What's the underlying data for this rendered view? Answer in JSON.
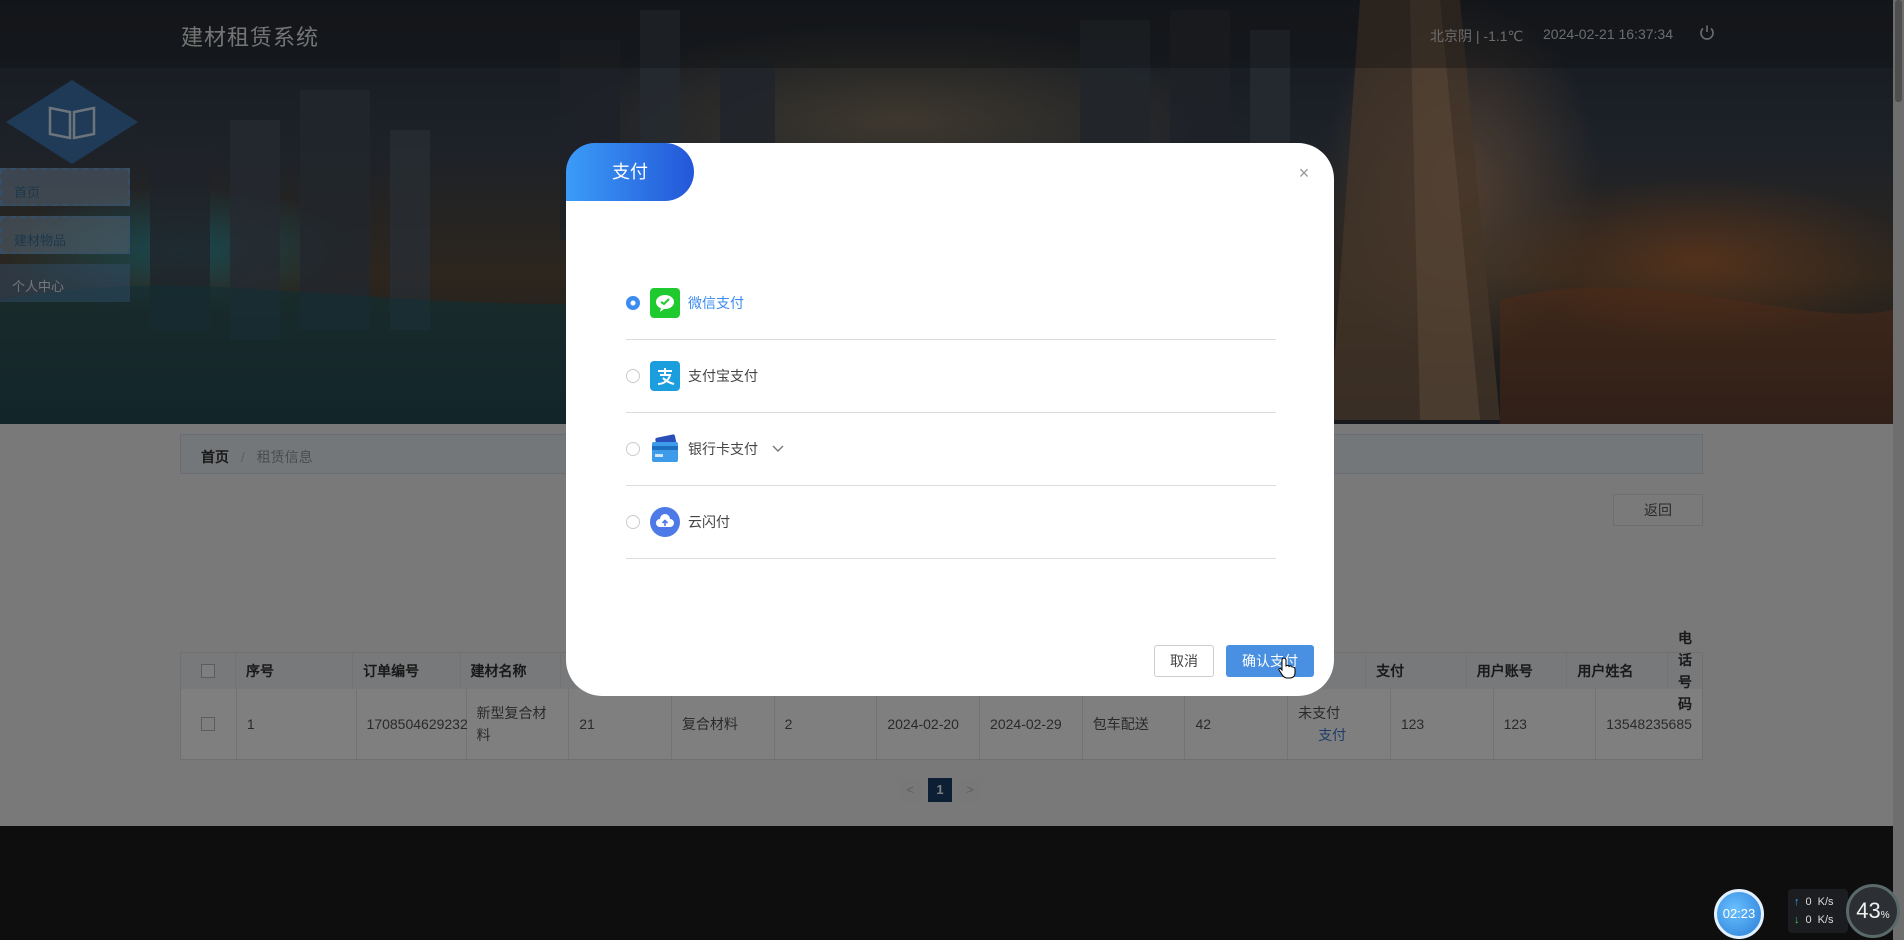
{
  "header": {
    "site_title": "建材租赁系统",
    "weather": "北京阴 | -1.1℃",
    "datetime": "2024-02-21   16:37:34"
  },
  "sidebar": {
    "items": [
      {
        "label": "首页"
      },
      {
        "label": "建材物品"
      },
      {
        "label": "个人中心"
      }
    ]
  },
  "breadcrumb": {
    "home": "首页",
    "separator": "/",
    "current": "租赁信息"
  },
  "back_button": "返回",
  "table": {
    "headers": [
      "序号",
      "订单编号",
      "建材名称",
      "",
      "",
      "",
      "",
      "",
      "",
      "",
      "",
      "支付",
      "用户账号",
      "用户姓名",
      "电话号码"
    ],
    "rows": [
      {
        "cells": [
          "1",
          "1708504629232",
          "新型复合材料",
          "21",
          "复合材料",
          "2",
          "2024-02-20",
          "2024-02-29",
          "包车配送",
          "42",
          "",
          "123",
          "123",
          "13548235685"
        ],
        "pay_status": "未支付",
        "pay_action": "支付"
      }
    ]
  },
  "pagination": {
    "prev": "<",
    "current": "1",
    "next": ">"
  },
  "modal": {
    "title": "支付",
    "close": "×",
    "options": [
      {
        "label": "微信支付",
        "icon": "wechat-pay-icon",
        "selected": true
      },
      {
        "label": "支付宝支付",
        "icon": "alipay-icon",
        "selected": false
      },
      {
        "label": "银行卡支付",
        "icon": "bank-card-icon",
        "selected": false,
        "has_dropdown": true
      },
      {
        "label": "云闪付",
        "icon": "unionpay-cloud-icon",
        "selected": false
      }
    ],
    "cancel": "取消",
    "confirm": "确认支付"
  },
  "widgets": {
    "timer": "02:23",
    "net_up": "0",
    "net_down": "0",
    "net_unit": "K/s",
    "cpu": "43",
    "cpu_unit": "%"
  },
  "colors": {
    "accent": "#4a90e2",
    "modal_tab_start": "#3b9cf7",
    "modal_tab_end": "#2357d9",
    "wechat": "#1fca2e",
    "alipay": "#1b9ede"
  }
}
